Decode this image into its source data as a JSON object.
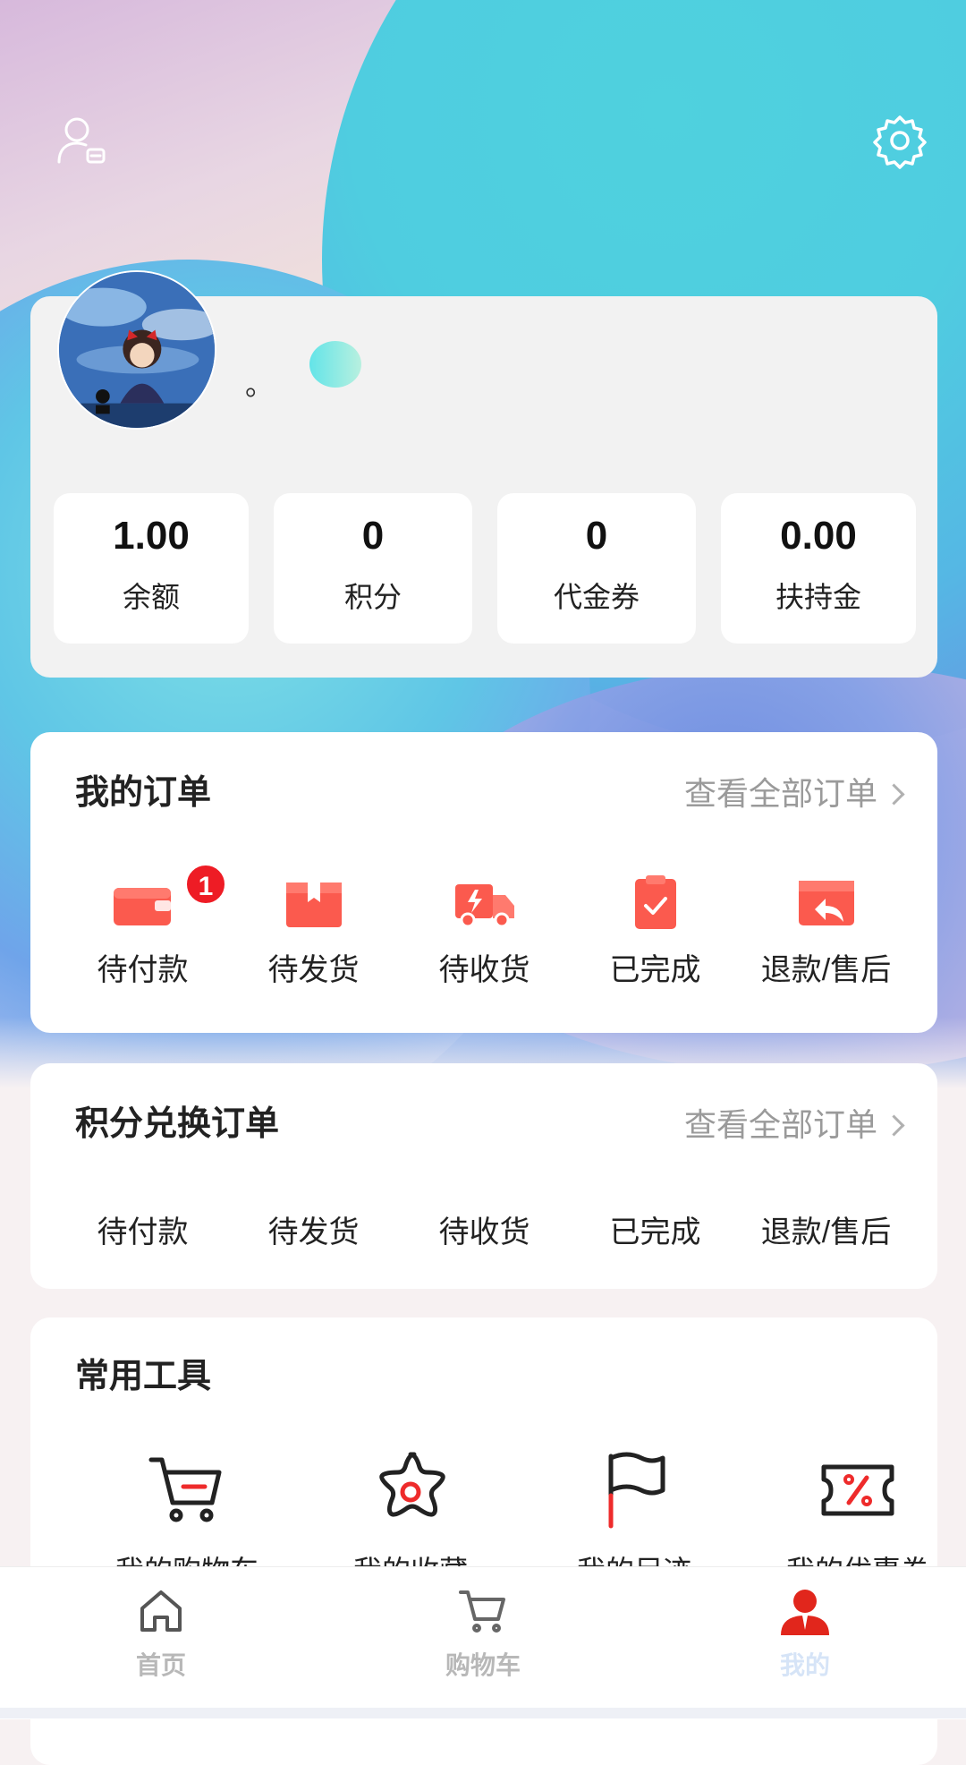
{
  "colors": {
    "accent": "#ee2b2b",
    "order_icon": "#fb5a4e",
    "active_tab_icon": "#e1261c"
  },
  "header": {
    "left_icon": "user-switch-icon",
    "right_icon": "gear-icon"
  },
  "profile": {
    "nickname": "。",
    "avatar": "avatar-image",
    "stats": [
      {
        "value": "1.00",
        "label": "余额"
      },
      {
        "value": "0",
        "label": "积分"
      },
      {
        "value": "0",
        "label": "代金券"
      },
      {
        "value": "0.00",
        "label": "扶持金"
      }
    ]
  },
  "my_orders": {
    "title": "我的订单",
    "link": "查看全部订单",
    "items": [
      {
        "label": "待付款",
        "icon": "wallet-icon",
        "badge": "1"
      },
      {
        "label": "待发货",
        "icon": "package-icon"
      },
      {
        "label": "待收货",
        "icon": "truck-icon"
      },
      {
        "label": "已完成",
        "icon": "clipboard-check-icon"
      },
      {
        "label": "退款/售后",
        "icon": "refund-icon"
      }
    ]
  },
  "points_orders": {
    "title": "积分兑换订单",
    "link": "查看全部订单",
    "items": [
      "待付款",
      "待发货",
      "待收货",
      "已完成",
      "退款/售后"
    ]
  },
  "tools": {
    "title": "常用工具",
    "items": [
      {
        "label": "我的购物车",
        "icon": "cart-icon"
      },
      {
        "label": "我的收藏",
        "icon": "star-icon"
      },
      {
        "label": "我的足迹",
        "icon": "flag-icon"
      },
      {
        "label": "我的优惠券",
        "icon": "coupon-icon"
      }
    ]
  },
  "tabbar": [
    {
      "label": "首页",
      "icon": "home-icon"
    },
    {
      "label": "购物车",
      "icon": "cart-icon"
    },
    {
      "label": "我的",
      "icon": "profile-icon",
      "active": true
    }
  ]
}
